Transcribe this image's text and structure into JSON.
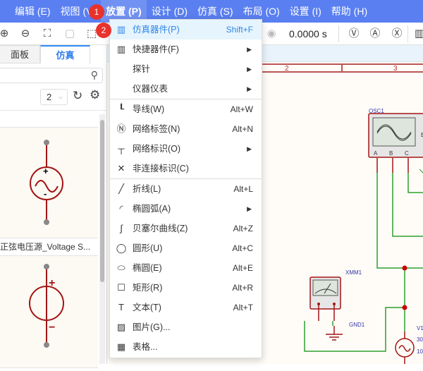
{
  "menubar": {
    "items": [
      "编辑 (E)",
      "视图 (V)",
      "放置 (P)",
      "设计 (D)",
      "仿真 (S)",
      "布局 (O)",
      "设置 (I)",
      "帮助 (H)"
    ],
    "active": "放置 (P)"
  },
  "toolbar": {
    "sim_time": "0.0000 s"
  },
  "left_panel": {
    "tabs": [
      "面板",
      "仿真"
    ],
    "active_tab": "仿真",
    "search_placeholder": "",
    "page_select": "2",
    "components": [
      {
        "label": "正弦电压源_Voltage S..."
      },
      {
        "label": ""
      }
    ]
  },
  "badges": [
    "1",
    "2"
  ],
  "place_menu": {
    "items": [
      {
        "icon": "chip-icon",
        "label": "仿真器件(P)",
        "shortcut": "Shift+F",
        "highlighted": true
      },
      {
        "icon": "chip-icon",
        "label": "快捷器件(F)",
        "submenu": true
      },
      {
        "icon": "",
        "label": "探针",
        "submenu": true
      },
      {
        "icon": "",
        "label": "仪器仪表",
        "submenu": true
      },
      {
        "separator": true
      },
      {
        "icon": "wire-icon",
        "label": "导线(W)",
        "shortcut": "Alt+W"
      },
      {
        "icon": "net-label-icon",
        "label": "网络标签(N)",
        "shortcut": "Alt+N"
      },
      {
        "icon": "vcc-icon",
        "label": "网络标识(O)",
        "submenu": true
      },
      {
        "icon": "x-icon",
        "label": "非连接标识(C)"
      },
      {
        "separator": true
      },
      {
        "icon": "polyline-icon",
        "label": "折线(L)",
        "shortcut": "Alt+L"
      },
      {
        "icon": "arc-icon",
        "label": "椭圆弧(A)",
        "submenu": true
      },
      {
        "icon": "bezier-icon",
        "label": "贝塞尔曲线(Z)",
        "shortcut": "Alt+Z"
      },
      {
        "icon": "circle-icon",
        "label": "圆形(U)",
        "shortcut": "Alt+C"
      },
      {
        "icon": "ellipse-icon",
        "label": "椭圆(E)",
        "shortcut": "Alt+E"
      },
      {
        "icon": "rect-icon",
        "label": "矩形(R)",
        "shortcut": "Alt+R"
      },
      {
        "icon": "text-icon",
        "label": "文本(T)",
        "shortcut": "Alt+T"
      },
      {
        "icon": "image-icon",
        "label": "图片(G)..."
      },
      {
        "icon": "table-icon",
        "label": "表格..."
      }
    ]
  },
  "canvas": {
    "ruler": [
      "2",
      "3"
    ],
    "labels": {
      "osc": "OSC1",
      "osc_pins": [
        "A",
        "B",
        "C"
      ],
      "osc_e": "E",
      "xmm": "XMM1",
      "gnd": "GND1",
      "v": "V1",
      "v_val1": "30",
      "v_val2": "10"
    }
  },
  "colors": {
    "menubar": "#5a7ff0",
    "accent": "#2f86e8",
    "wire": "#2e9e2e",
    "component": "#a31515",
    "badge": "#e8322b"
  }
}
